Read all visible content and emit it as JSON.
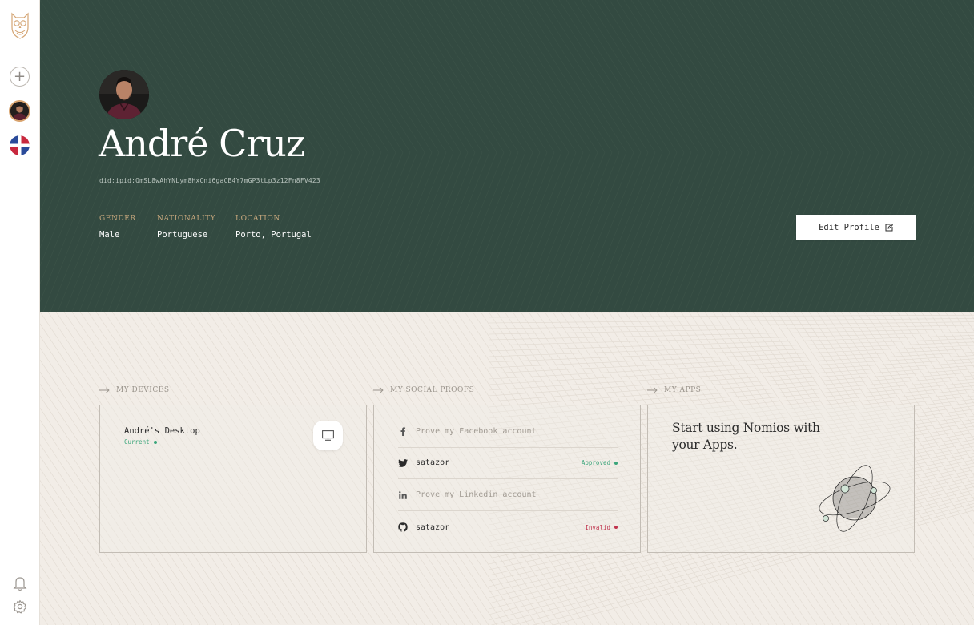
{
  "sidebar": {
    "logo": "owl-logo-icon",
    "add_symbol": "+",
    "items": [
      "add-identity",
      "user-avatar",
      "app-avatar"
    ],
    "bottom": [
      "bell-icon",
      "gear-icon"
    ]
  },
  "profile": {
    "name": "André Cruz",
    "did": "did:ipid:QmSL8wAhYNLym8HxCni6gaCB4Y7mGP3tLp3z12Fn8FV423",
    "fields": [
      {
        "label": "GENDER",
        "value": "Male"
      },
      {
        "label": "NATIONALITY",
        "value": "Portuguese"
      },
      {
        "label": "LOCATION",
        "value": "Porto, Portugal"
      }
    ],
    "edit_label": "Edit Profile"
  },
  "sections": {
    "devices_title": "MY DEVICES",
    "proofs_title": "MY SOCIAL PROOFS",
    "apps_title": "MY APPS"
  },
  "devices": [
    {
      "name": "André's Desktop",
      "status": "Current",
      "icon": "desktop-icon"
    }
  ],
  "social_proofs": [
    {
      "network": "facebook",
      "icon": "facebook-icon",
      "text": "Prove my Facebook account",
      "state": "placeholder",
      "badge": ""
    },
    {
      "network": "twitter",
      "icon": "twitter-icon",
      "text": "satazor",
      "state": "filled",
      "badge": "Approved"
    },
    {
      "network": "linkedin",
      "icon": "linkedin-icon",
      "text": "Prove my Linkedin account",
      "state": "placeholder",
      "badge": ""
    },
    {
      "network": "github",
      "icon": "github-icon",
      "text": "satazor",
      "state": "filled",
      "badge": "Invalid"
    }
  ],
  "apps": {
    "empty_text": "Start using Nomios with your Apps.",
    "illustration": "globe-illustration"
  },
  "colors": {
    "hero_bg": "#334a41",
    "page_bg": "#f2ede7",
    "gold": "#c9a97e",
    "approved": "#3aa57a",
    "invalid": "#c0334d"
  }
}
